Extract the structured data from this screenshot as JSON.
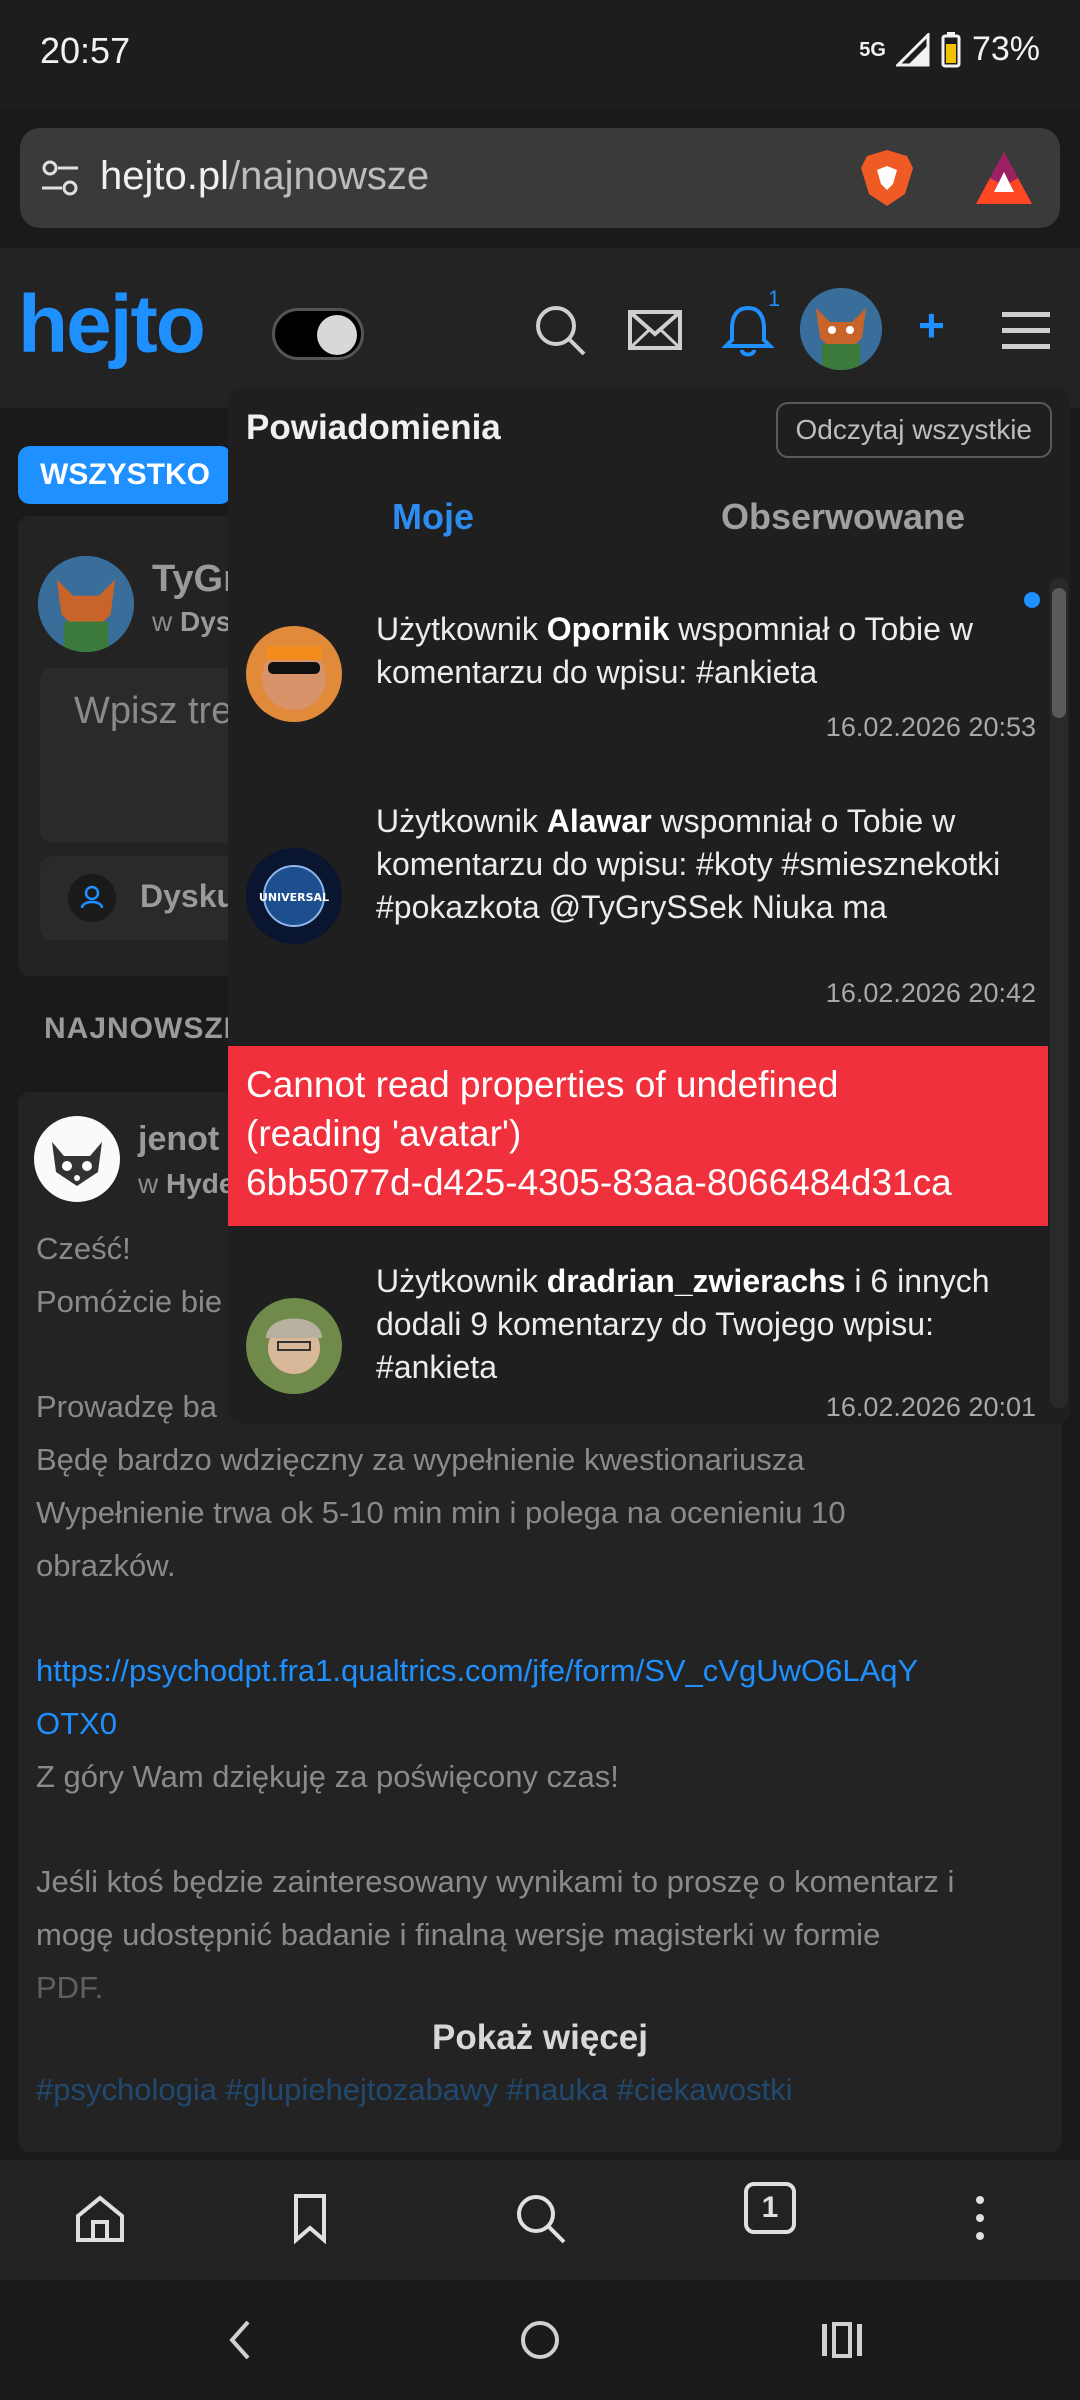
{
  "status_bar": {
    "time": "20:57",
    "network": "5G",
    "battery": "73%"
  },
  "browser": {
    "url_host": "hejto.pl",
    "url_path": "/najnowsze"
  },
  "header": {
    "logo": "hejto",
    "bell_badge": "1"
  },
  "feed": {
    "tab_all": "WSZYSTKO",
    "composer": {
      "name": "TyGr",
      "in_prefix": "w ",
      "in_community": "Dys",
      "placeholder": "Wpisz tre",
      "category": "Dysku"
    },
    "section_label": "NAJNOWSZE",
    "post": {
      "author": "jenot",
      "in_prefix": "w ",
      "community": "Hyde",
      "lines": {
        "l1": "Cześć!",
        "l2": "Pomóżcie bie",
        "l3": "Prowadzę ba",
        "l4": "Będę bardzo wdzięczny  za wypełnienie kwestionariusza",
        "l5": "Wypełnienie trwa ok 5-10 min min i polega na ocenieniu 10",
        "l6": "obrazków.",
        "link1": "https://psychodpt.fra1.qualtrics.com/jfe/form/SV_cVgUwO6LAqY",
        "link2": "OTX0",
        "l7": "Z góry Wam dziękuję za poświęcony czas!",
        "l8": "Jeśli ktoś będzie zainteresowany wynikami to proszę o komentarz i",
        "l9": "mogę udostępnić badanie i finalną wersje magisterki w formie",
        "l10": "PDF."
      },
      "tags": "#psychologia #glupiehejtozabawy #nauka #ciekawostki",
      "show_more": "Pokaż więcej"
    }
  },
  "notifications": {
    "title": "Powiadomienia",
    "read_all": "Odczytaj wszystkie",
    "tabs": {
      "mine": "Moje",
      "observed": "Obserwowane"
    },
    "items": [
      {
        "prefix": "Użytkownik ",
        "user": "Opornik",
        "text": " wspomniał o Tobie w komentarzu do wpisu: #ankieta",
        "date": "16.02.2026 20:53",
        "unread": true
      },
      {
        "prefix": "Użytkownik ",
        "user": "Alawar",
        "text": " wspomniał o Tobie w komentarzu do wpisu: #koty #smiesznekotki #pokazkota @TyGrySSek Niuka ma",
        "date": "16.02.2026 20:42",
        "avatar_label": "UNIVERSAL"
      },
      {
        "prefix": "Użytkownik ",
        "user": "dradrian_zwierachs",
        "text": " i 6 innych dodali 9 komentarzy do Twojego wpisu: #ankieta",
        "date": "16.02.2026 20:01"
      }
    ]
  },
  "error_toast": {
    "line1": "Cannot read properties of undefined",
    "line2": "(reading 'avatar')",
    "line3": "6bb5077d-d425-4305-83aa-8066484d31ca",
    "color": "#f0303c"
  },
  "bottom_nav": {
    "tab_count": "1"
  },
  "colors": {
    "accent": "#1e90ff",
    "background": "#1a1a1a",
    "error": "#f0303c"
  }
}
